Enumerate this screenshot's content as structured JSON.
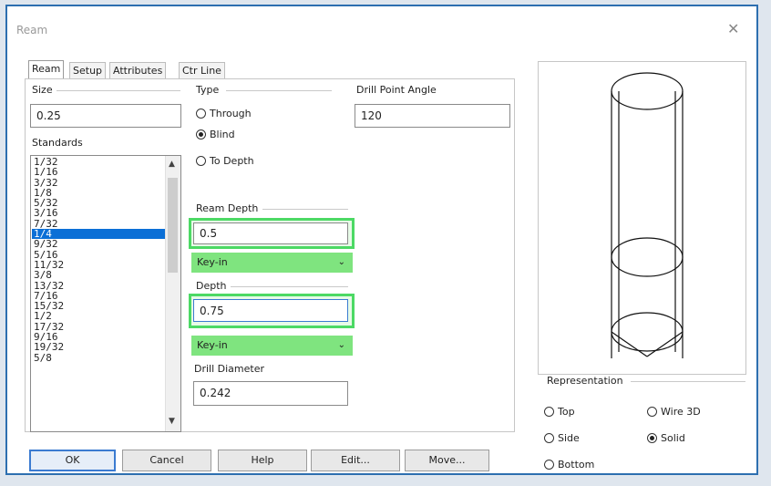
{
  "window": {
    "title": "Ream",
    "close_glyph": "✕"
  },
  "tabs": [
    "Ream",
    "Setup",
    "Attributes",
    "Ctr Line"
  ],
  "size": {
    "label": "Size",
    "value": "0.25"
  },
  "standards": {
    "label": "Standards",
    "items": [
      "1/32",
      "1/16",
      "3/32",
      "1/8",
      "5/32",
      "3/16",
      "7/32",
      "1/4",
      "9/32",
      "5/16",
      "11/32",
      "3/8",
      "13/32",
      "7/16",
      "15/32",
      "1/2",
      "17/32",
      "9/16",
      "19/32",
      "5/8"
    ],
    "selected": "1/4"
  },
  "type": {
    "label": "Type",
    "options": [
      {
        "label": "Through",
        "checked": false
      },
      {
        "label": "Blind",
        "checked": true
      },
      {
        "label": "To Depth",
        "checked": false
      }
    ]
  },
  "drill_point_angle": {
    "label": "Drill Point Angle",
    "value": "120"
  },
  "ream_depth": {
    "label": "Ream Depth",
    "value": "0.5",
    "mode": "Key-in"
  },
  "depth": {
    "label": "Depth",
    "value": "0.75",
    "mode": "Key-in"
  },
  "drill_diameter": {
    "label": "Drill Diameter",
    "value": "0.242"
  },
  "buttons": {
    "ok": "OK",
    "cancel": "Cancel",
    "help": "Help",
    "edit": "Edit...",
    "move": "Move..."
  },
  "representation": {
    "label": "Representation",
    "options": [
      {
        "label": "Top",
        "checked": false
      },
      {
        "label": "Wire 3D",
        "checked": false
      },
      {
        "label": "Side",
        "checked": false
      },
      {
        "label": "Solid",
        "checked": true
      },
      {
        "label": "Bottom",
        "checked": false
      }
    ]
  },
  "colors": {
    "highlight": "#4cd964",
    "selection": "#0b6fd6",
    "frame": "#2d6fb0"
  }
}
